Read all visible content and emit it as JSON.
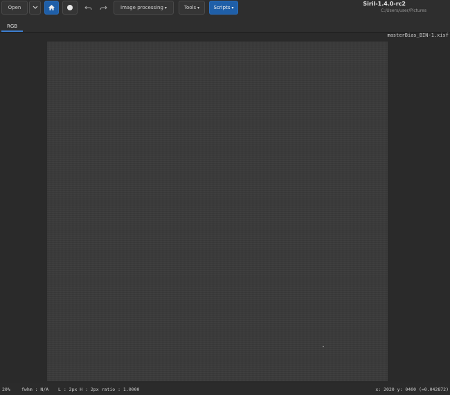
{
  "header": {
    "open_label": "Open",
    "processing_label": "Image processing",
    "tools_label": "Tools",
    "scripts_label": "Scripts",
    "app_title": "Siril-1.4.0-rc2",
    "app_subtitle": "C:/Users/user/Pictures",
    "icons": {
      "open_dropdown": "chevron-down-icon",
      "home": "home-icon",
      "live": "circle-icon",
      "undo": "undo-icon",
      "redo": "redo-icon"
    },
    "accent_color": "#1f5fa8"
  },
  "tabs": [
    {
      "label": "RGB"
    }
  ],
  "viewer": {
    "filename": "masterBias_BIN-1.xisf"
  },
  "status": {
    "zoom": "20%",
    "fwhm": "fwhm : N/A",
    "box": "L : 2px H : 2px ratio : 1.0000",
    "coords": "x: 2020 y: 0400 (=0.042872)"
  }
}
